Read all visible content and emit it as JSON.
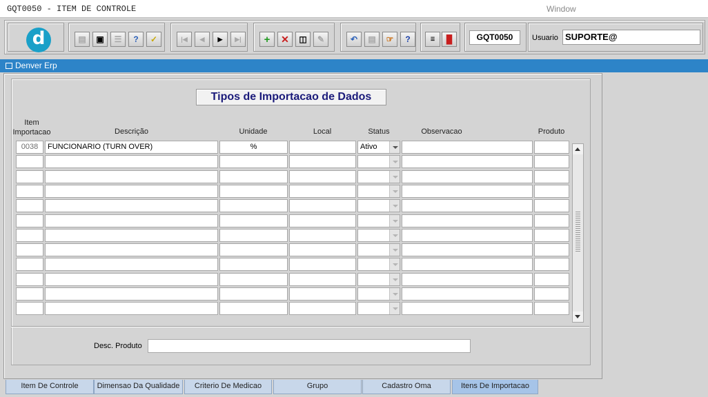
{
  "window": {
    "title": "GQT0050 - ITEM DE CONTROLE",
    "menu": "Window"
  },
  "toolbar": {
    "logo_letter": "d",
    "form_code": "GQT0050",
    "user_label": "Usuario",
    "user_value": "SUPORTE@"
  },
  "app_bar": {
    "title": "Denver Erp"
  },
  "form": {
    "title": "Tipos de Importacao de Dados",
    "columns": {
      "item_line1": "Item",
      "item_line2": "Importacao",
      "descricao": "Descrição",
      "unidade": "Unidade",
      "local": "Local",
      "status": "Status",
      "observacao": "Observacao",
      "produto": "Produto"
    },
    "rows": [
      {
        "item": "0038",
        "descricao": "FUNCIONARIO (TURN OVER)",
        "unidade": "%",
        "local": "",
        "status": "Ativo",
        "observacao": "",
        "produto": ""
      },
      {
        "item": "",
        "descricao": "",
        "unidade": "",
        "local": "",
        "status": "",
        "observacao": "",
        "produto": ""
      },
      {
        "item": "",
        "descricao": "",
        "unidade": "",
        "local": "",
        "status": "",
        "observacao": "",
        "produto": ""
      },
      {
        "item": "",
        "descricao": "",
        "unidade": "",
        "local": "",
        "status": "",
        "observacao": "",
        "produto": ""
      },
      {
        "item": "",
        "descricao": "",
        "unidade": "",
        "local": "",
        "status": "",
        "observacao": "",
        "produto": ""
      },
      {
        "item": "",
        "descricao": "",
        "unidade": "",
        "local": "",
        "status": "",
        "observacao": "",
        "produto": ""
      },
      {
        "item": "",
        "descricao": "",
        "unidade": "",
        "local": "",
        "status": "",
        "observacao": "",
        "produto": ""
      },
      {
        "item": "",
        "descricao": "",
        "unidade": "",
        "local": "",
        "status": "",
        "observacao": "",
        "produto": ""
      },
      {
        "item": "",
        "descricao": "",
        "unidade": "",
        "local": "",
        "status": "",
        "observacao": "",
        "produto": ""
      },
      {
        "item": "",
        "descricao": "",
        "unidade": "",
        "local": "",
        "status": "",
        "observacao": "",
        "produto": ""
      },
      {
        "item": "",
        "descricao": "",
        "unidade": "",
        "local": "",
        "status": "",
        "observacao": "",
        "produto": ""
      },
      {
        "item": "",
        "descricao": "",
        "unidade": "",
        "local": "",
        "status": "",
        "observacao": "",
        "produto": ""
      }
    ],
    "desc_produto_label": "Desc. Produto",
    "desc_produto_value": ""
  },
  "tabs": [
    {
      "label": "Item De Controle",
      "active": false
    },
    {
      "label": "Dimensao Da Qualidade",
      "active": false
    },
    {
      "label": "Criterio De Medicao",
      "active": false
    },
    {
      "label": "Grupo",
      "active": false
    },
    {
      "label": "Cadastro Oma",
      "active": false
    },
    {
      "label": "Itens De Importacao",
      "active": true
    }
  ],
  "colors": {
    "app_bar": "#2d84c8",
    "logo": "#1aa0c8",
    "title_text": "#1a1a7a",
    "active_tab": "#a6c4e8"
  }
}
